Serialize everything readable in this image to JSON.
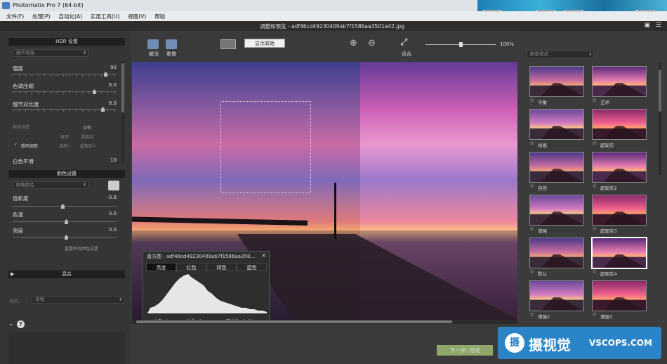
{
  "app": {
    "title": "Photomatix Pro 7  (64-bit)"
  },
  "menu": [
    "文件(F)",
    "处理(P)",
    "自动化(A)",
    "实用工具(U)",
    "视图(V)",
    "帮助"
  ],
  "document": {
    "title": "调整和预览 - adf46cd49230409ab7f1586aa3501a42.jpg"
  },
  "left": {
    "hdr_title": "HDR 设置",
    "method_dropdown": "细节增强",
    "sliders": [
      {
        "label": "强度",
        "value": "90",
        "pos": 0.9
      },
      {
        "label": "色调压缩",
        "value": "6.0",
        "pos": 0.8
      },
      {
        "label": "细节对比度",
        "value": "8.0",
        "pos": 0.88
      }
    ],
    "lighting_label": "照明调整",
    "lighting_mode": "中等",
    "lighting_opts": [
      "自然",
      "超现实",
      "自然+",
      "超现实+"
    ],
    "lighting_check": "照明调整",
    "smooth_label": "白色平滑",
    "smooth_value": "10",
    "color_title": "颜色设置",
    "color_dropdown": "图像颜色",
    "color_sliders": [
      {
        "label": "饱和度",
        "value": "-0.8",
        "pos": 0.45
      },
      {
        "label": "色温",
        "value": "0.0",
        "pos": 0.5
      },
      {
        "label": "亮度",
        "value": "0.0",
        "pos": 0.5
      }
    ],
    "reset_label": "重置所有颜色设置",
    "blend_title": "混合",
    "blend_label": "修饰:",
    "blend_dropdown": "增强"
  },
  "toolbar": {
    "undo": "撤消",
    "redo": "重做",
    "show_original": "显示原始",
    "fit": "适合",
    "zoom": "100%"
  },
  "histogram": {
    "title": "直方图 - adf46cd49230409ab7f1586aa350...",
    "close": "×",
    "tabs": [
      "亮度",
      "红色",
      "绿色",
      "蓝色"
    ],
    "stats": [
      "水平: 0",
      "计数: 0",
      "百分比: 0.00"
    ]
  },
  "bottom": {
    "next": "下一步: 完成"
  },
  "right": {
    "filter_dropdown": "所有作式",
    "presets": [
      "平衡",
      "艺术",
      "绘画",
      "超现实",
      "自然",
      "超现实2",
      "增强",
      "超现实3",
      "默认",
      "超现实4",
      "增强2",
      "增强3"
    ]
  },
  "watermark": {
    "logo": "摄",
    "brand": "摄视觉",
    "url": "VSCOPS.COM"
  },
  "colors": {
    "accent": "#2a84c7",
    "panel": "#353535",
    "next_button": "#8fa86a"
  },
  "icons": [
    "undo-icon",
    "redo-icon",
    "fit-icon",
    "zoom-in-icon",
    "zoom-out-icon",
    "star-icon",
    "close-icon",
    "save-icon",
    "menu-icon",
    "brush-icon"
  ]
}
